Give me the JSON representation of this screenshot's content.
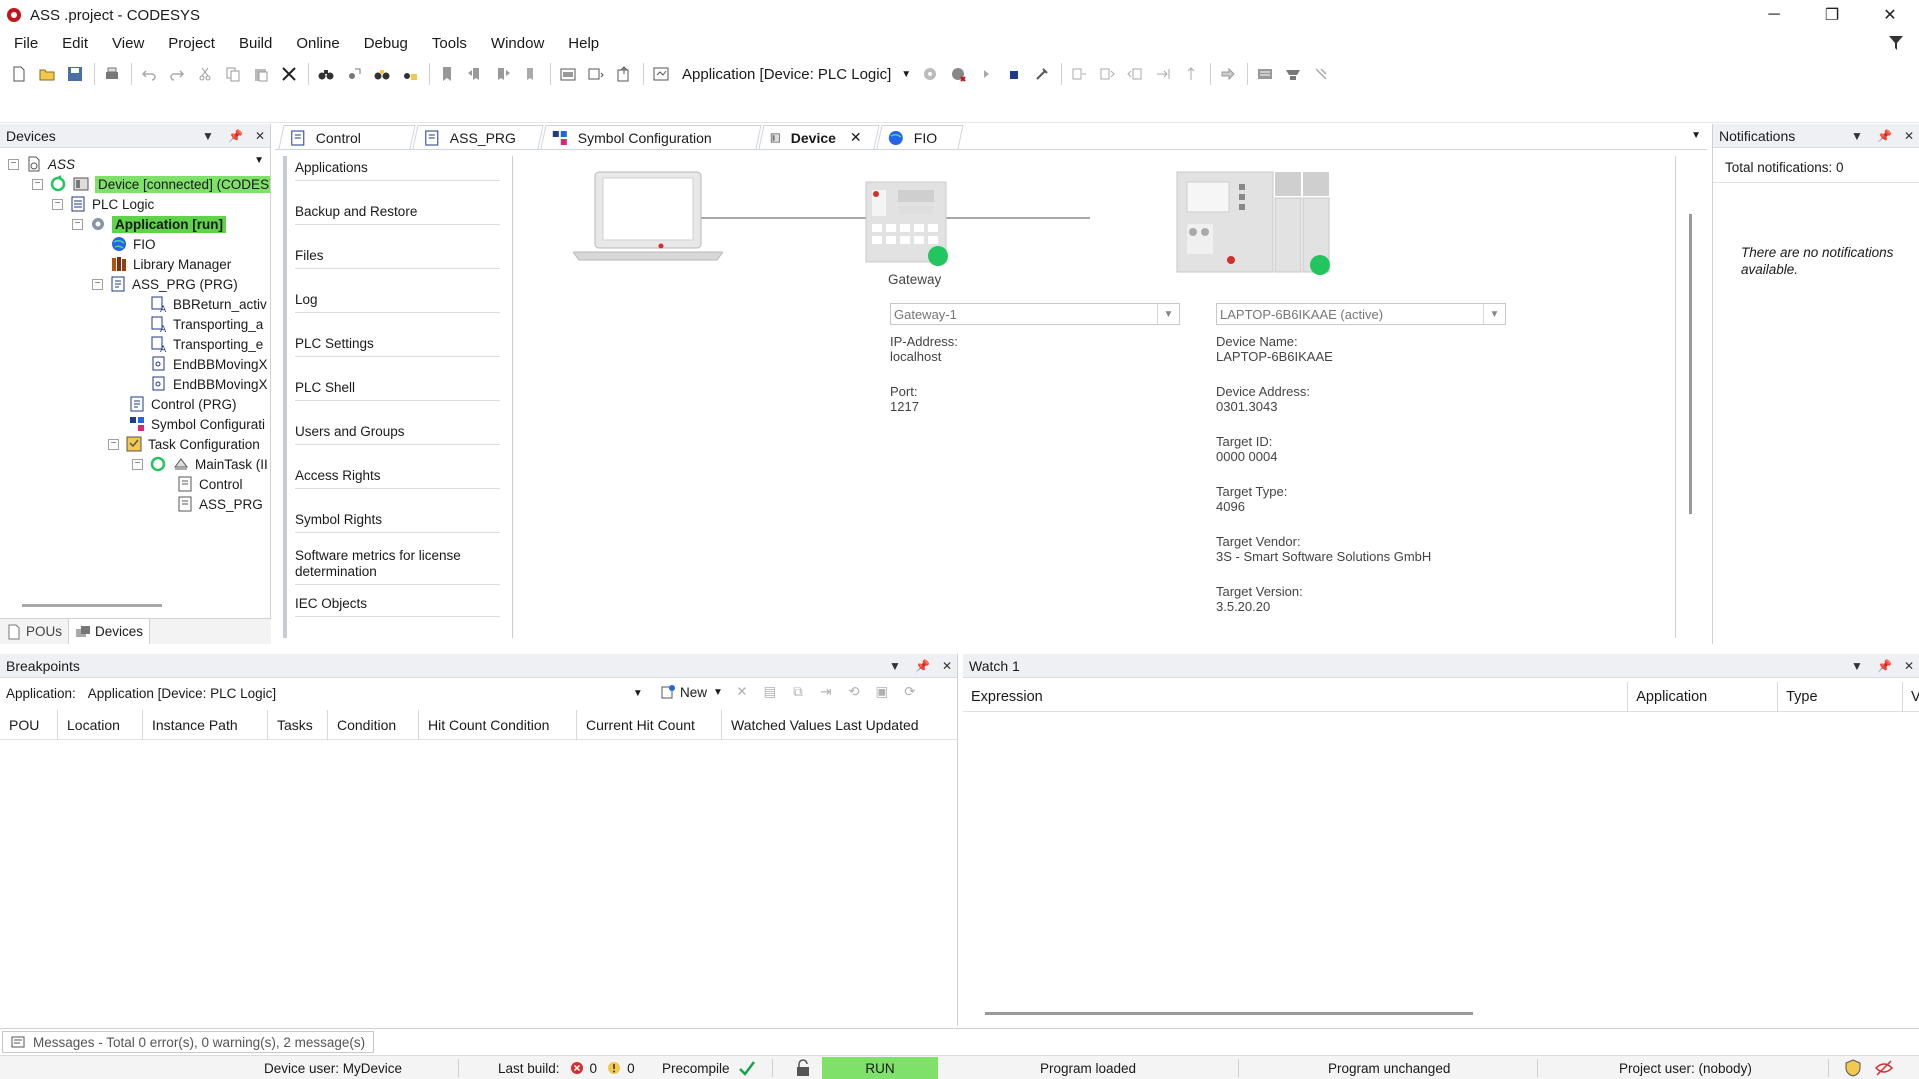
{
  "window": {
    "title": "ASS .project - CODESYS",
    "minimize": "─",
    "restore": "❐",
    "close": "✕"
  },
  "menu": [
    "File",
    "Edit",
    "View",
    "Project",
    "Build",
    "Online",
    "Debug",
    "Tools",
    "Window",
    "Help"
  ],
  "toolbar": {
    "active_application": "Application [Device: PLC Logic]"
  },
  "devices_panel": {
    "title": "Devices",
    "tree": [
      {
        "label": "ASS",
        "style": "italic"
      },
      {
        "label": "Device [connected] (CODESYS",
        "style": "green"
      },
      {
        "label": "PLC Logic"
      },
      {
        "label": "Application [run]",
        "style": "green-bold"
      },
      {
        "label": "FIO"
      },
      {
        "label": "Library Manager"
      },
      {
        "label": "ASS_PRG (PRG)"
      },
      {
        "label": "BBReturn_activ"
      },
      {
        "label": "Transporting_a"
      },
      {
        "label": "Transporting_e"
      },
      {
        "label": "EndBBMovingX"
      },
      {
        "label": "EndBBMovingX"
      },
      {
        "label": "Control (PRG)"
      },
      {
        "label": "Symbol Configurati"
      },
      {
        "label": "Task Configuration"
      },
      {
        "label": "MainTask (II"
      },
      {
        "label": "Control"
      },
      {
        "label": "ASS_PRG"
      }
    ],
    "bottom_tabs": [
      "POUs",
      "Devices"
    ]
  },
  "editor_tabs": [
    {
      "label": "Control"
    },
    {
      "label": "ASS_PRG"
    },
    {
      "label": "Symbol Configuration"
    },
    {
      "label": "Device",
      "active": true
    },
    {
      "label": "FIO"
    }
  ],
  "device_nav": [
    "Applications",
    "Backup and Restore",
    "Files",
    "Log",
    "PLC Settings",
    "PLC Shell",
    "Users and Groups",
    "Access Rights",
    "Symbol Rights",
    "Software metrics for license determination",
    "IEC Objects"
  ],
  "gateway": {
    "label": "Gateway",
    "combo": "Gateway-1",
    "ip_label": "IP-Address:",
    "ip_value": "localhost",
    "port_label": "Port:",
    "port_value": "1217"
  },
  "device": {
    "combo": "LAPTOP-6B6IKAAE (active)",
    "fields": [
      {
        "label": "Device Name:",
        "value": "LAPTOP-6B6IKAAE"
      },
      {
        "label": "Device Address:",
        "value": "0301.3043"
      },
      {
        "label": "Target ID:",
        "value": "0000  0004"
      },
      {
        "label": "Target Type:",
        "value": "4096"
      },
      {
        "label": "Target Vendor:",
        "value": "3S - Smart Software Solutions GmbH"
      },
      {
        "label": "Target Version:",
        "value": "3.5.20.20"
      }
    ]
  },
  "notifications": {
    "title": "Notifications",
    "total": "Total notifications: 0",
    "empty": "There are no notifications available."
  },
  "breakpoints": {
    "title": "Breakpoints",
    "app_label": "Application:",
    "app_value": "Application [Device: PLC Logic]",
    "new_label": "New",
    "columns": [
      "POU",
      "Location",
      "Instance Path",
      "Tasks",
      "Condition",
      "Hit Count Condition",
      "Current Hit Count",
      "Watched Values Last Updated"
    ]
  },
  "watch": {
    "title": "Watch 1",
    "columns": [
      "Expression",
      "Application",
      "Type",
      "V"
    ]
  },
  "messages": {
    "label": "Messages - Total 0 error(s), 0 warning(s), 2 message(s)"
  },
  "status": {
    "device_user": "Device user: MyDevice",
    "last_build_label": "Last build:",
    "errors": "0",
    "warnings": "0",
    "precompile": "Precompile",
    "run": "RUN",
    "program_loaded": "Program loaded",
    "program_unchanged": "Program unchanged",
    "project_user": "Project user: (nobody)"
  },
  "colors": {
    "run_green": "#7fe06a",
    "status_green": "#22c55e",
    "panel_header": "#eef0f4"
  }
}
